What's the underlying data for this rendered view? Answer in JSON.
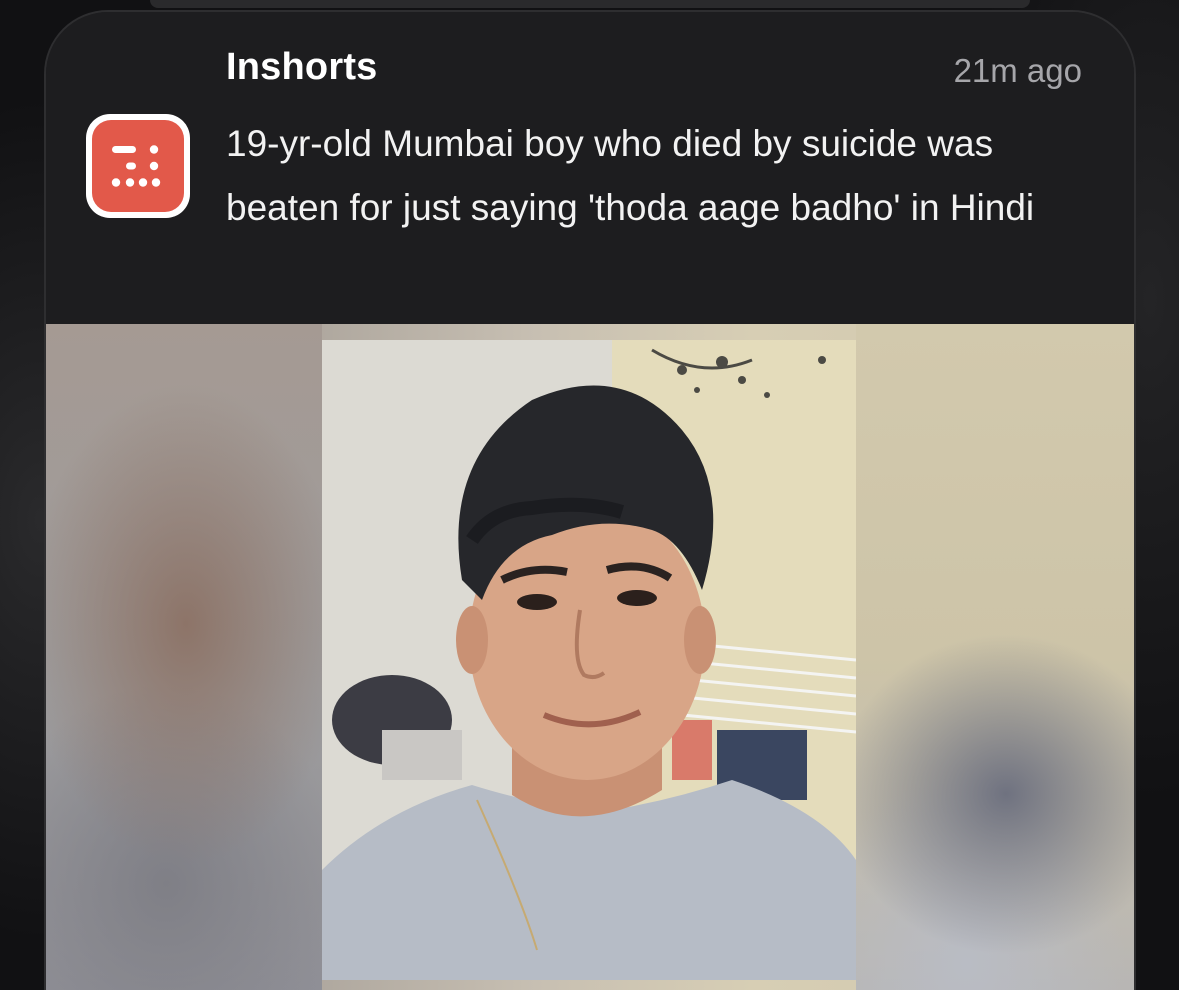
{
  "notification": {
    "app_name": "Inshorts",
    "timestamp": "21m ago",
    "headline": "19-yr-old Mumbai boy who died by suicide was beaten for just saying 'thoda aage badho' in Hindi",
    "app_icon": "inshorts-logo-icon",
    "accent_color": "#e2594a"
  }
}
